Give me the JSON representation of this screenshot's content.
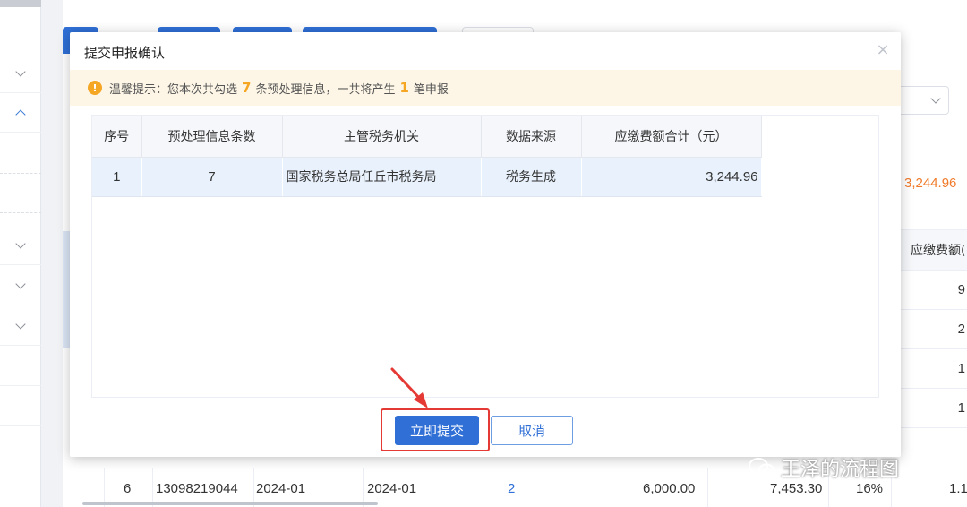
{
  "background": {
    "total_amount": "3,244.96",
    "column_header": "应缴费额(",
    "column_values": [
      "9",
      "2",
      "1",
      "1"
    ],
    "bottom_row": {
      "index": "6",
      "id": "13098219044",
      "period_start": "2024-01",
      "period_end": "2024-01",
      "link_count": "2",
      "amount": "6,000.00",
      "amount2": "7,453.30",
      "rate": "16%",
      "tail": "1.1"
    }
  },
  "dialog": {
    "title": "提交申报确认",
    "notice": {
      "prefix": "温馨提示：您本次共勾选",
      "selected_count": "7",
      "middle": "条预处理信息，一共将产生",
      "report_count": "1",
      "suffix": "笔申报"
    },
    "table": {
      "columns": [
        "序号",
        "预处理信息条数",
        "主管税务机关",
        "数据来源",
        "应缴费额合计（元）"
      ],
      "rows": [
        {
          "index": "1",
          "count": "7",
          "authority": "国家税务总局任丘市税务局",
          "source": "税务生成",
          "total": "3,244.96"
        }
      ]
    },
    "submit_label": "立即提交",
    "cancel_label": "取消"
  },
  "watermark": "王泽的流程图",
  "colors": {
    "primary": "#2f6fd6",
    "warning": "#f5a623",
    "highlight_box": "#e53935",
    "amount_orange": "#f07b2a"
  }
}
